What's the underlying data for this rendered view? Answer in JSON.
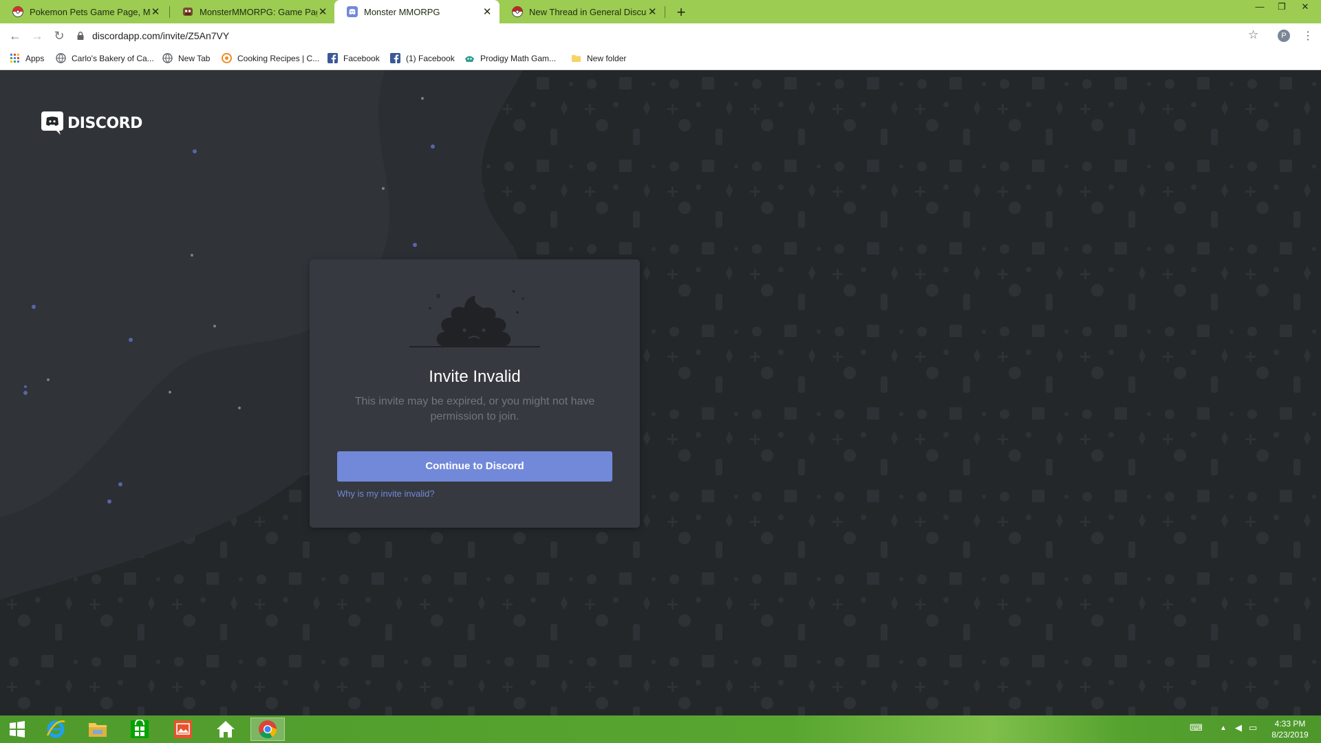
{
  "browser": {
    "tabs": [
      {
        "title": "Pokemon Pets Game Page, Map",
        "active": false,
        "favicon": "pokeball-icon"
      },
      {
        "title": "MonsterMMORPG: Game Page -",
        "active": false,
        "favicon": "monster-icon"
      },
      {
        "title": "Monster MMORPG",
        "active": true,
        "favicon": "discord-icon"
      },
      {
        "title": "New Thread in General Discussio",
        "active": false,
        "favicon": "pokeball-icon"
      }
    ],
    "new_tab_label": "+",
    "url": "discordapp.com/invite/Z5An7VY",
    "profile_initial": "P",
    "bookmarks": [
      {
        "label": "Apps",
        "icon": "apps-grid-icon"
      },
      {
        "label": "Carlo's Bakery of Ca...",
        "icon": "globe-icon"
      },
      {
        "label": "New Tab",
        "icon": "globe-icon"
      },
      {
        "label": "Cooking Recipes | C...",
        "icon": "recipe-icon"
      },
      {
        "label": "Facebook",
        "icon": "facebook-icon"
      },
      {
        "label": "(1) Facebook",
        "icon": "facebook-icon"
      },
      {
        "label": "Prodigy Math Gam...",
        "icon": "prodigy-icon"
      },
      {
        "label": "New folder",
        "icon": "folder-icon"
      }
    ]
  },
  "discord": {
    "logo_text": "DISCORD",
    "card": {
      "title": "Invite Invalid",
      "description": "This invite may be expired, or you might not have permission to join.",
      "button_label": "Continue to Discord",
      "help_link": "Why is my invite invalid?"
    },
    "colors": {
      "blurple": "#7289da",
      "card_bg": "#36393f",
      "page_bg": "#23272a"
    }
  },
  "taskbar": {
    "apps": [
      "windows-start-icon",
      "internet-explorer-icon",
      "file-explorer-icon",
      "store-icon",
      "photos-icon",
      "home-icon",
      "chrome-icon"
    ],
    "clock_time": "4:33 PM",
    "clock_date": "8/23/2019"
  }
}
